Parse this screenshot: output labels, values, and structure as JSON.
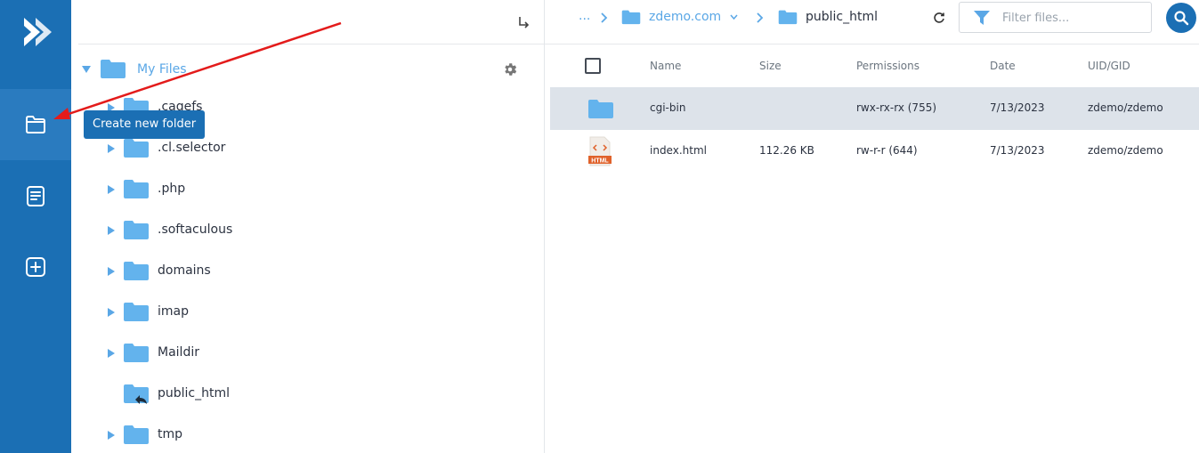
{
  "rail": {
    "items": [
      {
        "icon": "logo-icon"
      },
      {
        "icon": "new-folder-icon",
        "active": true
      },
      {
        "icon": "new-file-icon"
      },
      {
        "icon": "upload-icon"
      }
    ]
  },
  "tooltip": {
    "text": "Create new folder"
  },
  "tree": {
    "root_label": "My Files",
    "items": [
      {
        "label": ".cagefs",
        "expandable": true
      },
      {
        "label": ".cl.selector",
        "expandable": true
      },
      {
        "label": ".php",
        "expandable": true
      },
      {
        "label": ".softaculous",
        "expandable": true
      },
      {
        "label": "domains",
        "expandable": true
      },
      {
        "label": "imap",
        "expandable": true
      },
      {
        "label": "Maildir",
        "expandable": true
      },
      {
        "label": "public_html",
        "expandable": false,
        "shortcut": true
      },
      {
        "label": "tmp",
        "expandable": true
      }
    ]
  },
  "breadcrumb": {
    "ellipsis": "...",
    "domain": "zdemo.com",
    "current": "public_html"
  },
  "filter": {
    "placeholder": "Filter files..."
  },
  "table": {
    "headers": {
      "name": "Name",
      "size": "Size",
      "permissions": "Permissions",
      "date": "Date",
      "uid": "UID/GID"
    },
    "rows": [
      {
        "type": "folder",
        "name": "cgi-bin",
        "size": "",
        "permissions": "rwx-rx-rx (755)",
        "date": "7/13/2023",
        "uid": "zdemo/zdemo",
        "selected": true
      },
      {
        "type": "html-file",
        "icon_label": "HTML",
        "name": "index.html",
        "size": "112.26 KB",
        "permissions": "rw-r-r (644)",
        "date": "7/13/2023",
        "uid": "zdemo/zdemo",
        "selected": false
      }
    ]
  },
  "colors": {
    "accent": "#1b6fb4",
    "folder": "#63b3ed",
    "selected_row": "#dde3ea",
    "annotation_arrow": "#e31b1b"
  }
}
